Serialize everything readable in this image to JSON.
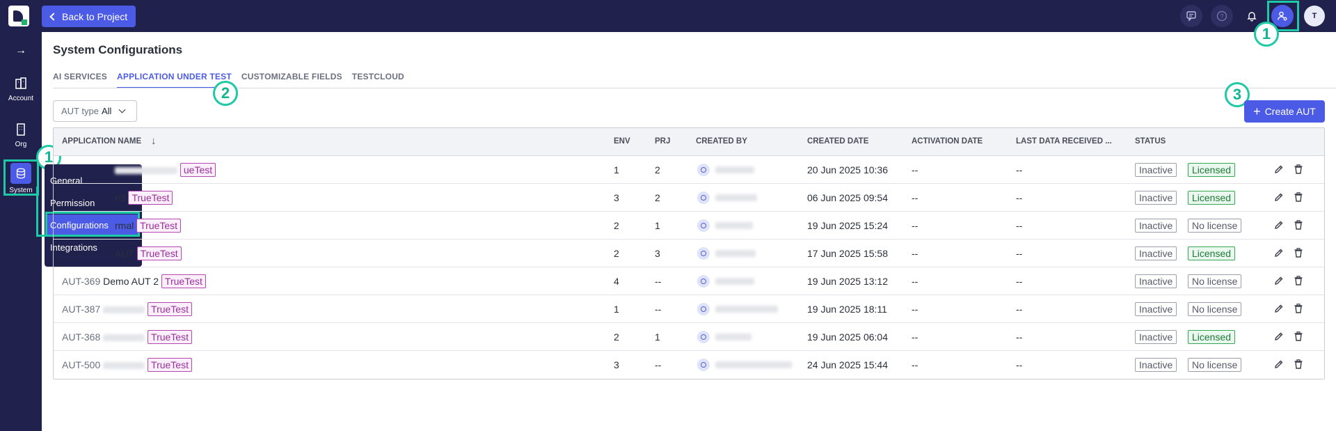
{
  "topbar": {
    "back_label": "Back to Project",
    "user_initial": "T",
    "icons": [
      "feedback-icon",
      "help-icon",
      "bell-icon",
      "user-settings-icon"
    ]
  },
  "annotations": {
    "callout_1": "1",
    "callout_2": "2",
    "callout_3": "3",
    "highlight_color": "#1ec9a5"
  },
  "sidebar": {
    "items": [
      {
        "label": "Account",
        "icon": "building-icon"
      },
      {
        "label": "Org",
        "icon": "office-icon"
      },
      {
        "label": "System",
        "icon": "database-icon"
      }
    ],
    "submenu": [
      "General",
      "Permission",
      "Configurations",
      "Integrations"
    ]
  },
  "page": {
    "title": "System Configurations",
    "tabs": [
      "AI SERVICES",
      "APPLICATION UNDER TEST",
      "CUSTOMIZABLE FIELDS",
      "TESTCLOUD"
    ],
    "active_tab": "APPLICATION UNDER TEST",
    "filter_label": "AUT type",
    "filter_value": "All",
    "create_label": "Create AUT"
  },
  "table": {
    "columns": [
      "APPLICATION NAME",
      "ENV",
      "PRJ",
      "CREATED BY",
      "CREATED DATE",
      "ACTIVATION DATE",
      "LAST DATA RECEIVED ...",
      "STATUS"
    ],
    "rows": [
      {
        "id": "",
        "name": "",
        "tag": "TrueTest",
        "tag_partial": "ueTest",
        "env": "1",
        "prj": "2",
        "created": "20 Jun 2025 10:36",
        "activation": "--",
        "last": "--",
        "status": "Inactive",
        "license": "Licensed"
      },
      {
        "id": "",
        "name": "n3",
        "tag": "TrueTest",
        "env": "3",
        "prj": "2",
        "created": "06 Jun 2025 09:54",
        "activation": "--",
        "last": "--",
        "status": "Inactive",
        "license": "Licensed"
      },
      {
        "id": "",
        "name": "rmal",
        "tag": "TrueTest",
        "env": "2",
        "prj": "1",
        "created": "19 Jun 2025 15:24",
        "activation": "--",
        "last": "--",
        "status": "Inactive",
        "license": "No license"
      },
      {
        "id": "",
        "name": "AUT",
        "tag": "TrueTest",
        "env": "2",
        "prj": "3",
        "created": "17 Jun 2025 15:58",
        "activation": "--",
        "last": "--",
        "status": "Inactive",
        "license": "Licensed"
      },
      {
        "id": "AUT-369",
        "name": "Demo AUT 2",
        "tag": "TrueTest",
        "env": "4",
        "prj": "--",
        "created": "19 Jun 2025 13:12",
        "activation": "--",
        "last": "--",
        "status": "Inactive",
        "license": "No license"
      },
      {
        "id": "AUT-387",
        "name": "",
        "tag": "TrueTest",
        "env": "1",
        "prj": "--",
        "created": "19 Jun 2025 18:11",
        "activation": "--",
        "last": "--",
        "status": "Inactive",
        "license": "No license"
      },
      {
        "id": "AUT-368",
        "name": "",
        "tag": "TrueTest",
        "env": "2",
        "prj": "1",
        "created": "19 Jun 2025 06:04",
        "activation": "--",
        "last": "--",
        "status": "Inactive",
        "license": "Licensed"
      },
      {
        "id": "AUT-500",
        "name": "",
        "tag": "TrueTest",
        "env": "3",
        "prj": "--",
        "created": "24 Jun 2025 15:44",
        "activation": "--",
        "last": "--",
        "status": "Inactive",
        "license": "No license"
      }
    ]
  },
  "colors": {
    "accent": "#4c5be5",
    "nav": "#21214e",
    "tag": "#b548b3",
    "licensed": "#34a853"
  }
}
